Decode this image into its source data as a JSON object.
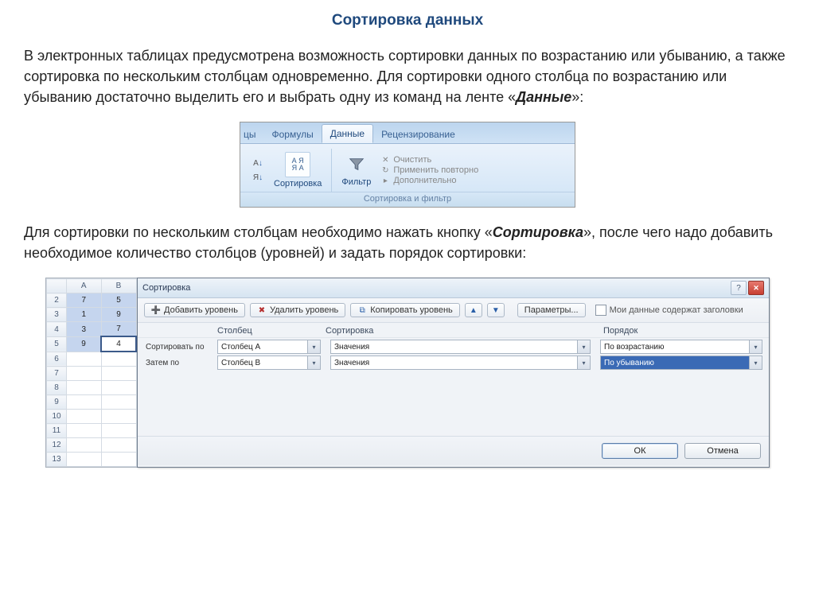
{
  "title": "Сортировка данных",
  "para1_prefix": "В электронных таблицах предусмотрена возможность сортировки данных по возрастанию или убыванию, а также сортировка по нескольким столбцам одновременно. Для сортировки одного столбца по возрастанию или убыванию достаточно выделить его и выбрать одну из команд на ленте «",
  "para1_emph": "Данные",
  "para1_suffix": "»:",
  "para2_prefix": "Для сортировки по нескольким столбцам необходимо нажать кнопку «",
  "para2_emph": "Сортировка",
  "para2_suffix": "», после чего надо добавить необходимое количество столбцов  (уровней) и задать порядок сортировки:",
  "ribbon": {
    "tab_frag": "цы",
    "tabs": [
      "Формулы",
      "Данные",
      "Рецензирование"
    ],
    "active_tab": "Данные",
    "sort_asc_label": "А↓",
    "sort_desc_label": "Я↓",
    "sort_btn": "Сортировка",
    "filter_btn": "Фильтр",
    "clear": "Очистить",
    "reapply": "Применить повторно",
    "advanced": "Дополнительно",
    "group_caption": "Сортировка и фильтр"
  },
  "sheet": {
    "cols": [
      "A",
      "B"
    ],
    "rows": [
      {
        "n": 2,
        "a": "7",
        "b": "5"
      },
      {
        "n": 3,
        "a": "1",
        "b": "9"
      },
      {
        "n": 4,
        "a": "3",
        "b": "7"
      },
      {
        "n": 5,
        "a": "9",
        "b": "4"
      },
      {
        "n": 6,
        "a": "",
        "b": ""
      },
      {
        "n": 7,
        "a": "",
        "b": ""
      },
      {
        "n": 8,
        "a": "",
        "b": ""
      },
      {
        "n": 9,
        "a": "",
        "b": ""
      },
      {
        "n": 10,
        "a": "",
        "b": ""
      },
      {
        "n": 11,
        "a": "",
        "b": ""
      },
      {
        "n": 12,
        "a": "",
        "b": ""
      },
      {
        "n": 13,
        "a": "",
        "b": ""
      }
    ]
  },
  "dialog": {
    "title": "Сортировка",
    "add_level": "Добавить уровень",
    "del_level": "Удалить уровень",
    "copy_level": "Копировать уровень",
    "options": "Параметры...",
    "has_headers": "Мои данные содержат заголовки",
    "hdr_col": "Столбец",
    "hdr_sort": "Сортировка",
    "hdr_order": "Порядок",
    "rows": [
      {
        "label": "Сортировать по",
        "col": "Столбец A",
        "sortby": "Значения",
        "order": "По возрастанию",
        "selected": false
      },
      {
        "label": "Затем по",
        "col": "Столбец B",
        "sortby": "Значения",
        "order": "По убыванию",
        "selected": true
      }
    ],
    "ok": "ОК",
    "cancel": "Отмена"
  }
}
